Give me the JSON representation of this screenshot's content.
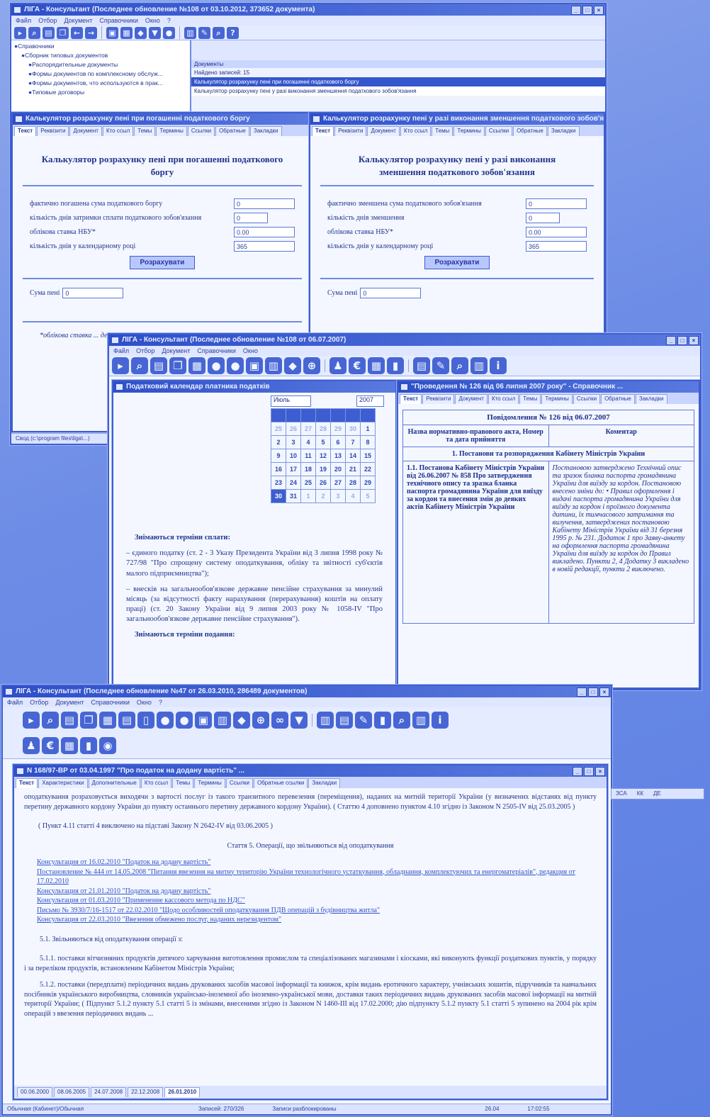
{
  "win1": {
    "title": "ЛІГА - Консультант (Последнее обновление №108 от 03.10.2012, 373652 документа)",
    "menu": [
      "Файл",
      "Отбор",
      "Документ",
      "Справочники",
      "Окно",
      "?"
    ],
    "tree": [
      "Справочники",
      "Сборник типовых документов",
      "Распорядительные документы",
      "Формы документов по комплексному обслуж...",
      "Формы документов, что используются в прак...",
      "Типовые договоры"
    ],
    "list_header": "Документы",
    "list_found": "Найдено записей: 15",
    "list_rows": [
      "Калькулятор розрахунку пені при погашенні податкового боргу",
      "Калькулятор розрахунку пені у разі виконання зменшення податкового зобов'язання"
    ]
  },
  "calcA": {
    "title": "Калькулятор розрахунку пені при погашенні податкового боргу",
    "tabs": [
      "Текст",
      "Реквізити",
      "Документ",
      "Кто ссыл",
      "Темы",
      "Термины",
      "Ссылки",
      "Обратные",
      "Закладки"
    ],
    "heading": "Калькулятор розрахунку пені при погашенні податкового боргу",
    "fields": [
      {
        "label": "фактично погашена сума податкового боргу",
        "value": "0"
      },
      {
        "label": "кількість днів затримки сплати податкового зобов'язання",
        "value": "0"
      },
      {
        "label": "облікова ставка НБУ*",
        "value": "0.00"
      },
      {
        "label": "кількість днів у календарному році",
        "value": "365"
      }
    ],
    "button": "Розрахувати",
    "result_label": "Сума пені",
    "result_value": "0",
    "note": "*облікова ставка ... день погашення"
  },
  "calcB": {
    "title": "Калькулятор розрахунку пені у разі виконання зменшення податкового зобов'язання",
    "tabs": [
      "Текст",
      "Реквізити",
      "Документ",
      "Кто ссыл",
      "Темы",
      "Термины",
      "Ссылки",
      "Обратные",
      "Закладки"
    ],
    "heading": "Калькулятор розрахунку пені у разі виконання зменшення податкового зобов'язання",
    "fields": [
      {
        "label": "фактично зменшена сума податкового зобов'язання",
        "value": "0"
      },
      {
        "label": "кількість днів зменшення",
        "value": "0"
      },
      {
        "label": "облікова ставка НБУ*",
        "value": "0.00"
      },
      {
        "label": "кількість днів у календарному році",
        "value": "365"
      }
    ],
    "button": "Розрахувати",
    "result_label": "Сума пені",
    "result_value": "0"
  },
  "win1_status": "Свод (c:\\program files\\liga\\...)",
  "win2": {
    "title": "ЛІГА - Консультант (Последнее обновление №108 от 06.07.2007)",
    "menu": [
      "Файл",
      "Отбор",
      "Документ",
      "Справочники",
      "Окно"
    ],
    "cal_window_title": "Податковий календар платника податків",
    "cal_month": "Июль",
    "cal_year": "2007",
    "cal_weeks": [
      [
        "25",
        "26",
        "27",
        "28",
        "29",
        "30",
        "1"
      ],
      [
        "2",
        "3",
        "4",
        "5",
        "6",
        "7",
        "8"
      ],
      [
        "9",
        "10",
        "11",
        "12",
        "13",
        "14",
        "15"
      ],
      [
        "16",
        "17",
        "18",
        "19",
        "20",
        "21",
        "22"
      ],
      [
        "23",
        "24",
        "25",
        "26",
        "27",
        "28",
        "29"
      ],
      [
        "30",
        "31",
        "1",
        "2",
        "3",
        "4",
        "5"
      ]
    ],
    "cal_text_h1": "Знімаються терміни сплати:",
    "cal_text_p1": "– єдиного податку (ст. 2 - 3 Указу Президента України від 3 липня 1998 року № 727/98 \"Про спрощену систему оподаткування, обліку та звітності суб'єктів малого підприємництва\");",
    "cal_text_p2": "– внесків на загальнообов'язкове державне пенсійне страхування за минулий місяць (за відсутності факту нарахування (перерахування) коштів на оплату праці) (ст. 20 Закону України від 9 липня 2003 року № 1058-IV \"Про загальнообов'язкове державне пенсійне страхування\").",
    "cal_text_h2": "Знімаються терміни подання:",
    "right_title": "\"Проведення № 126 від 06 липня 2007 року\" - Справочник ...",
    "right_tabs": [
      "Текст",
      "Реквізити",
      "Документ",
      "Кто ссыл",
      "Темы",
      "Термины",
      "Ссылки",
      "Обратные",
      "Закладки"
    ],
    "table_title": "Повідомлення № 126 від 06.07.2007",
    "col1_head": "Назва нормативно-правового акта, Номер та дата прийняття",
    "col2_head": "Коментар",
    "section": "1. Постанови та розпорядження Кабінету Міністрів України",
    "row_left": "1.1. Постанова Кабінету Міністрів України від 26.06.2007 № 858 Про затвердження технічного опису та зразка бланка паспорта громадянина України для виїзду за кордон та внесення змін до деяких актів Кабінету Міністрів України",
    "row_right": "Постановою затверджено Технічний опис та зразок бланка паспорта громадянина України для виїзду за кордон. Постановою внесено зміни до: • Правил оформлення і видачі паспорта громадянина України для виїзду за кордон і проїзного документа дитини, їх тимчасового затримання та вилучення, затверджених постановою Кабінету Міністрів України від 31 березня 1995 р. № 231. Додаток 1 про Заяву-анкету на оформлення паспорта громадянина України для виїзду за кордон до Правил викладено. Пункти 2, 4 Додатку 3 викладено в новій редакції, пункти 2 виключено."
  },
  "win3": {
    "title": "ЛІГА - Консультант (Последнее обновление №47 от 26.03.2010, 286489 документов)",
    "menu": [
      "Файл",
      "Отбор",
      "Документ",
      "Справочники",
      "Окно",
      "?"
    ],
    "doc_title": "N 168/97-ВР от 03.04.1997 \"Про податок на додану вартість\" ...",
    "tabs": [
      "Текст",
      "Характеристики",
      "Дополнительные",
      "Кто ссыл",
      "Темы",
      "Термины",
      "Ссылки",
      "Обратные ссылки",
      "Закладки"
    ],
    "p1": "оподаткування розраховується виходячи з вартості послуг із такого транзитного перевезення (переміщення), наданих на митній території України (у визначених відстанях від пункту перетину державного кордону України до пункту останнього перетину державного кордону України). ( Статтю 4 доповнено пунктом 4.10 згідно із Законом N 2505-IV від 25.03.2005 )",
    "p2": "( Пункт 4.11 статті 4 виключено на підставі Закону N 2642-IV від 03.06.2005 )",
    "article": "Стаття 5. Операції, що звільняються від оподаткування",
    "links": [
      "Консультация от 16.02.2010 \"Податок на додану вартість\"",
      "Постановление № 444 от 14.05.2008 \"Питання ввезення на митну територію України технологічного устаткування, обладнання, комплектуючих та енергоматеріалів\", редакция от 17.02.2010",
      "Консультация от 21.01.2010 \"Податок на додану вартість\"",
      "Консультация от 01.03.2010 \"Применение кассового метода по НДС\"",
      "Письмо № 3930/7/16-1517 от 22.02.2010 \"Щодо особливостей оподаткування ПДВ операцій з будівництва житла\"",
      "Консультация от 22.03.2010 \"Ввезення обмежено послуг, наданих нерезидентом\""
    ],
    "p3": "5.1. Звільняються від оподаткування операції з:",
    "p4": "5.1.1. поставки вітчизняних продуктів дитячого харчування виготовлення промислом та спеціалізованих магазинами і кіосками, які виконують функції роздаткових пунктів, у порядку і за переліком продуктів, встановленим Кабінетом Міністрів України;",
    "p5": "5.1.2. поставки (передплати) періодичних видань друкованих засобів масової інформації та книжок, крім видань еротичного характеру, учнівських зошитів, підручників та навчальних посібників українського виробництва, словників українсько-іноземної або іноземно-української мови, доставки таких періодичних видань друкованих засобів масової інформації на митній території України; ( Підпункт 5.1.2 пункту 5.1 статті 5 із змінами, внесеними згідно із Законом N 1460-III від 17.02.2000; дію підпункту 5.1.2 пункту 5.1 статті 5 зупинено на 2004 рік крім операцій з ввезення періодичних видань ...",
    "bottom_tabs": [
      "00.06.2000",
      "08.06.2005",
      "24.07.2008",
      "22.12.2008",
      "26.01.2010"
    ],
    "status": [
      "Обычная (Кабинет)/Обычная",
      "Записей: 270/326",
      "Записи разблокированы",
      "26.04",
      "17:02:55"
    ],
    "right_status": [
      "ЗСА",
      "КК",
      "ДЕ"
    ]
  }
}
